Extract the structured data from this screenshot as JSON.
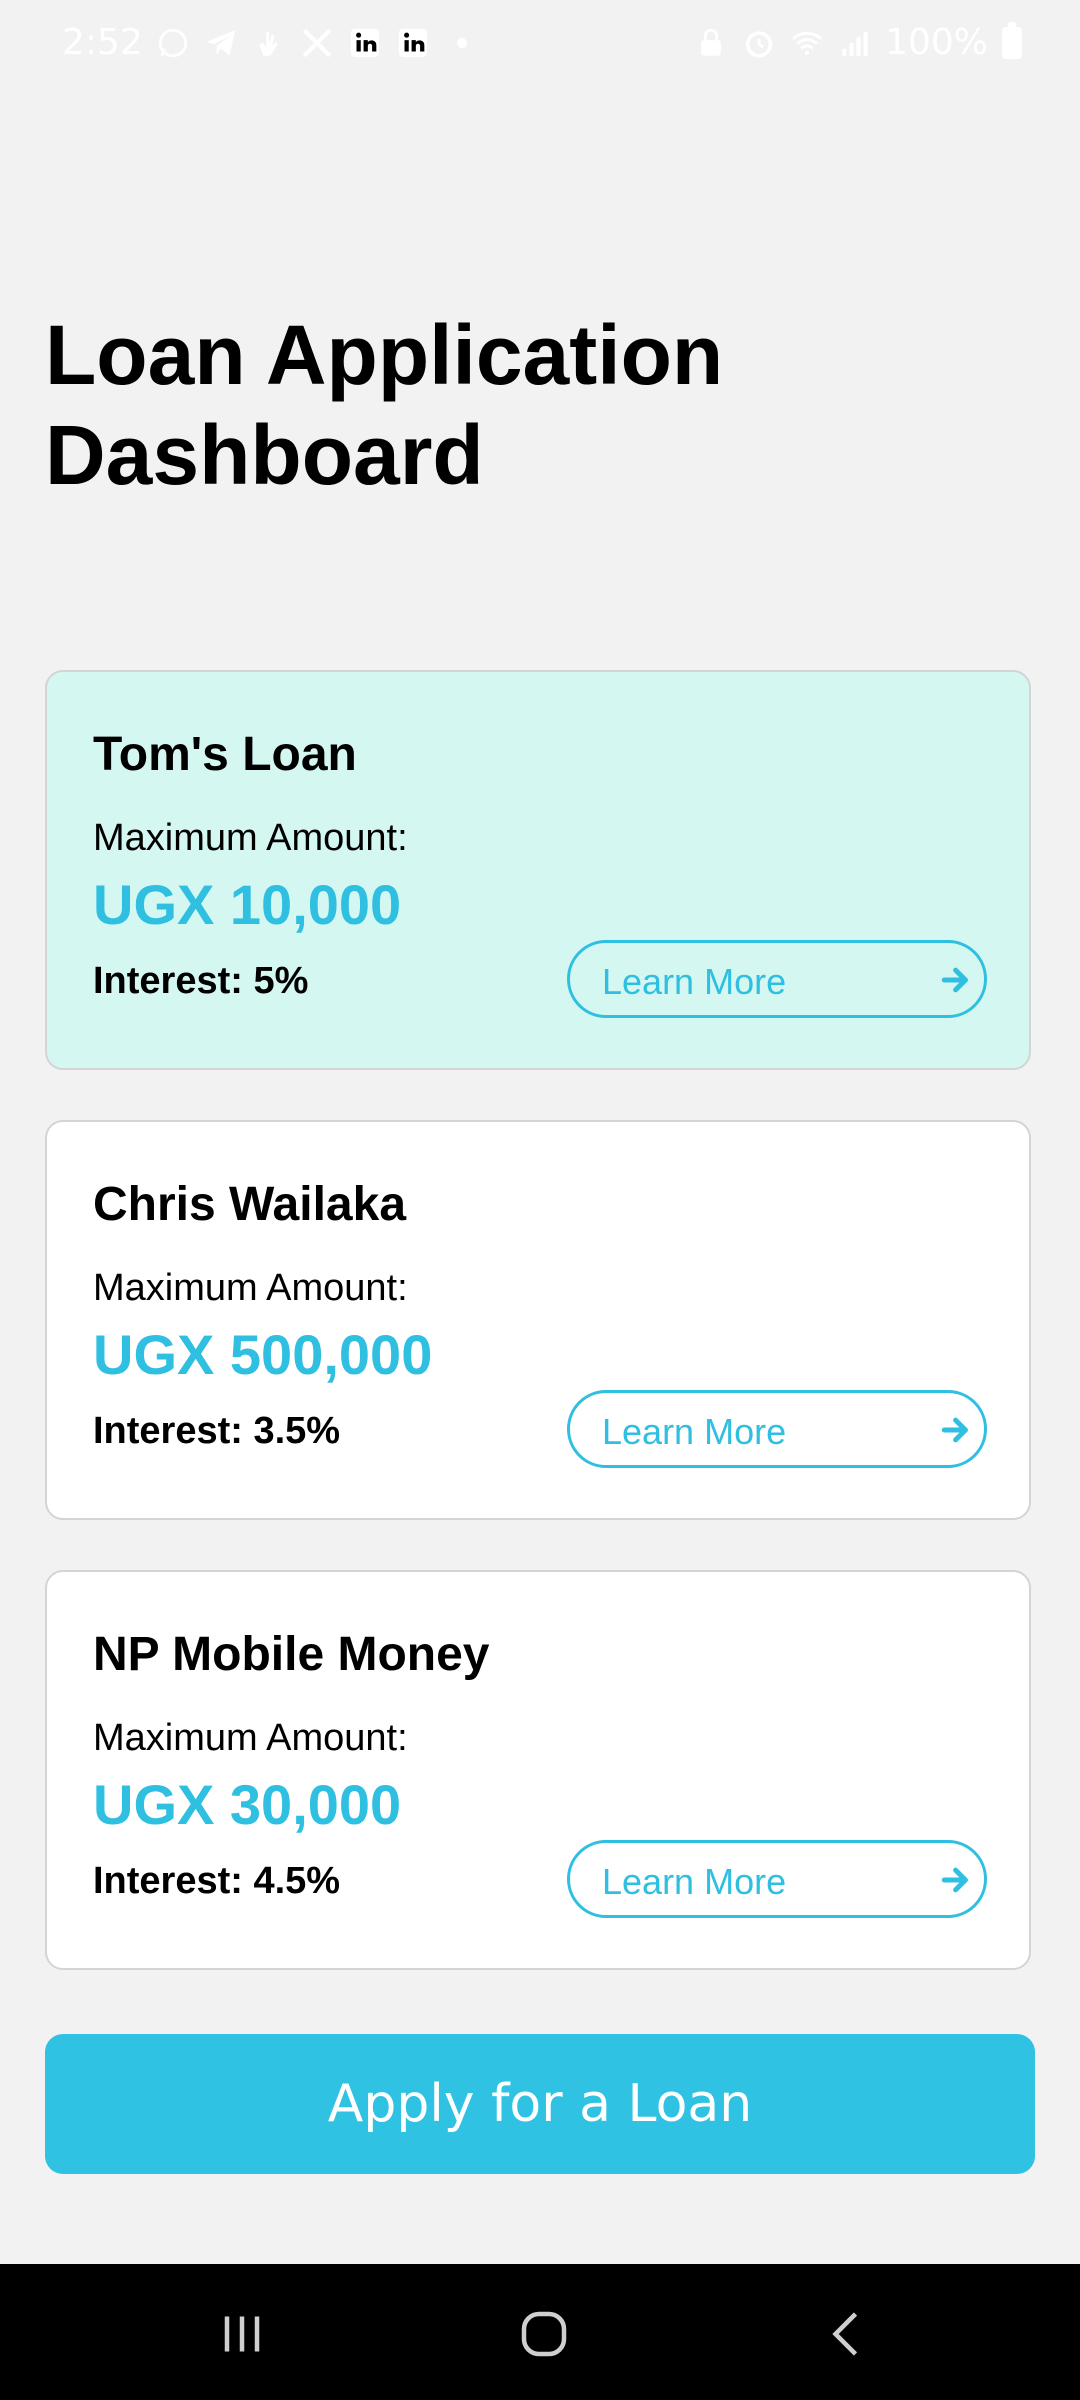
{
  "status_bar": {
    "time": "2:52",
    "battery": "100%",
    "left_icons": [
      "whatsapp-icon",
      "telegram-icon",
      "hand-icon",
      "x-icon",
      "linkedin-icon",
      "linkedin-icon"
    ],
    "right_icons": [
      "lock-icon",
      "alarm-icon",
      "wifi-icon",
      "signal-icon",
      "battery-icon"
    ]
  },
  "page": {
    "title": "Loan Application Dashboard"
  },
  "loans": [
    {
      "name": "Tom's Loan",
      "amount_label": "Maximum Amount:",
      "amount": "UGX 10,000",
      "interest": "Interest: 5%",
      "button": "Learn More",
      "highlighted": true
    },
    {
      "name": "Chris Wailaka",
      "amount_label": "Maximum Amount:",
      "amount": "UGX 500,000",
      "interest": "Interest: 3.5%",
      "button": "Learn More",
      "highlighted": false
    },
    {
      "name": "NP Mobile Money",
      "amount_label": "Maximum Amount:",
      "amount": "UGX 30,000",
      "interest": "Interest: 4.5%",
      "button": "Learn More",
      "highlighted": false
    }
  ],
  "actions": {
    "apply_label": "Apply for a Loan"
  },
  "colors": {
    "accent": "#2fbfe0",
    "highlight_card": "#d4f7f2",
    "background": "#f2f2f2"
  },
  "nav": {
    "icons": [
      "recent-apps-icon",
      "home-icon",
      "back-icon"
    ]
  }
}
